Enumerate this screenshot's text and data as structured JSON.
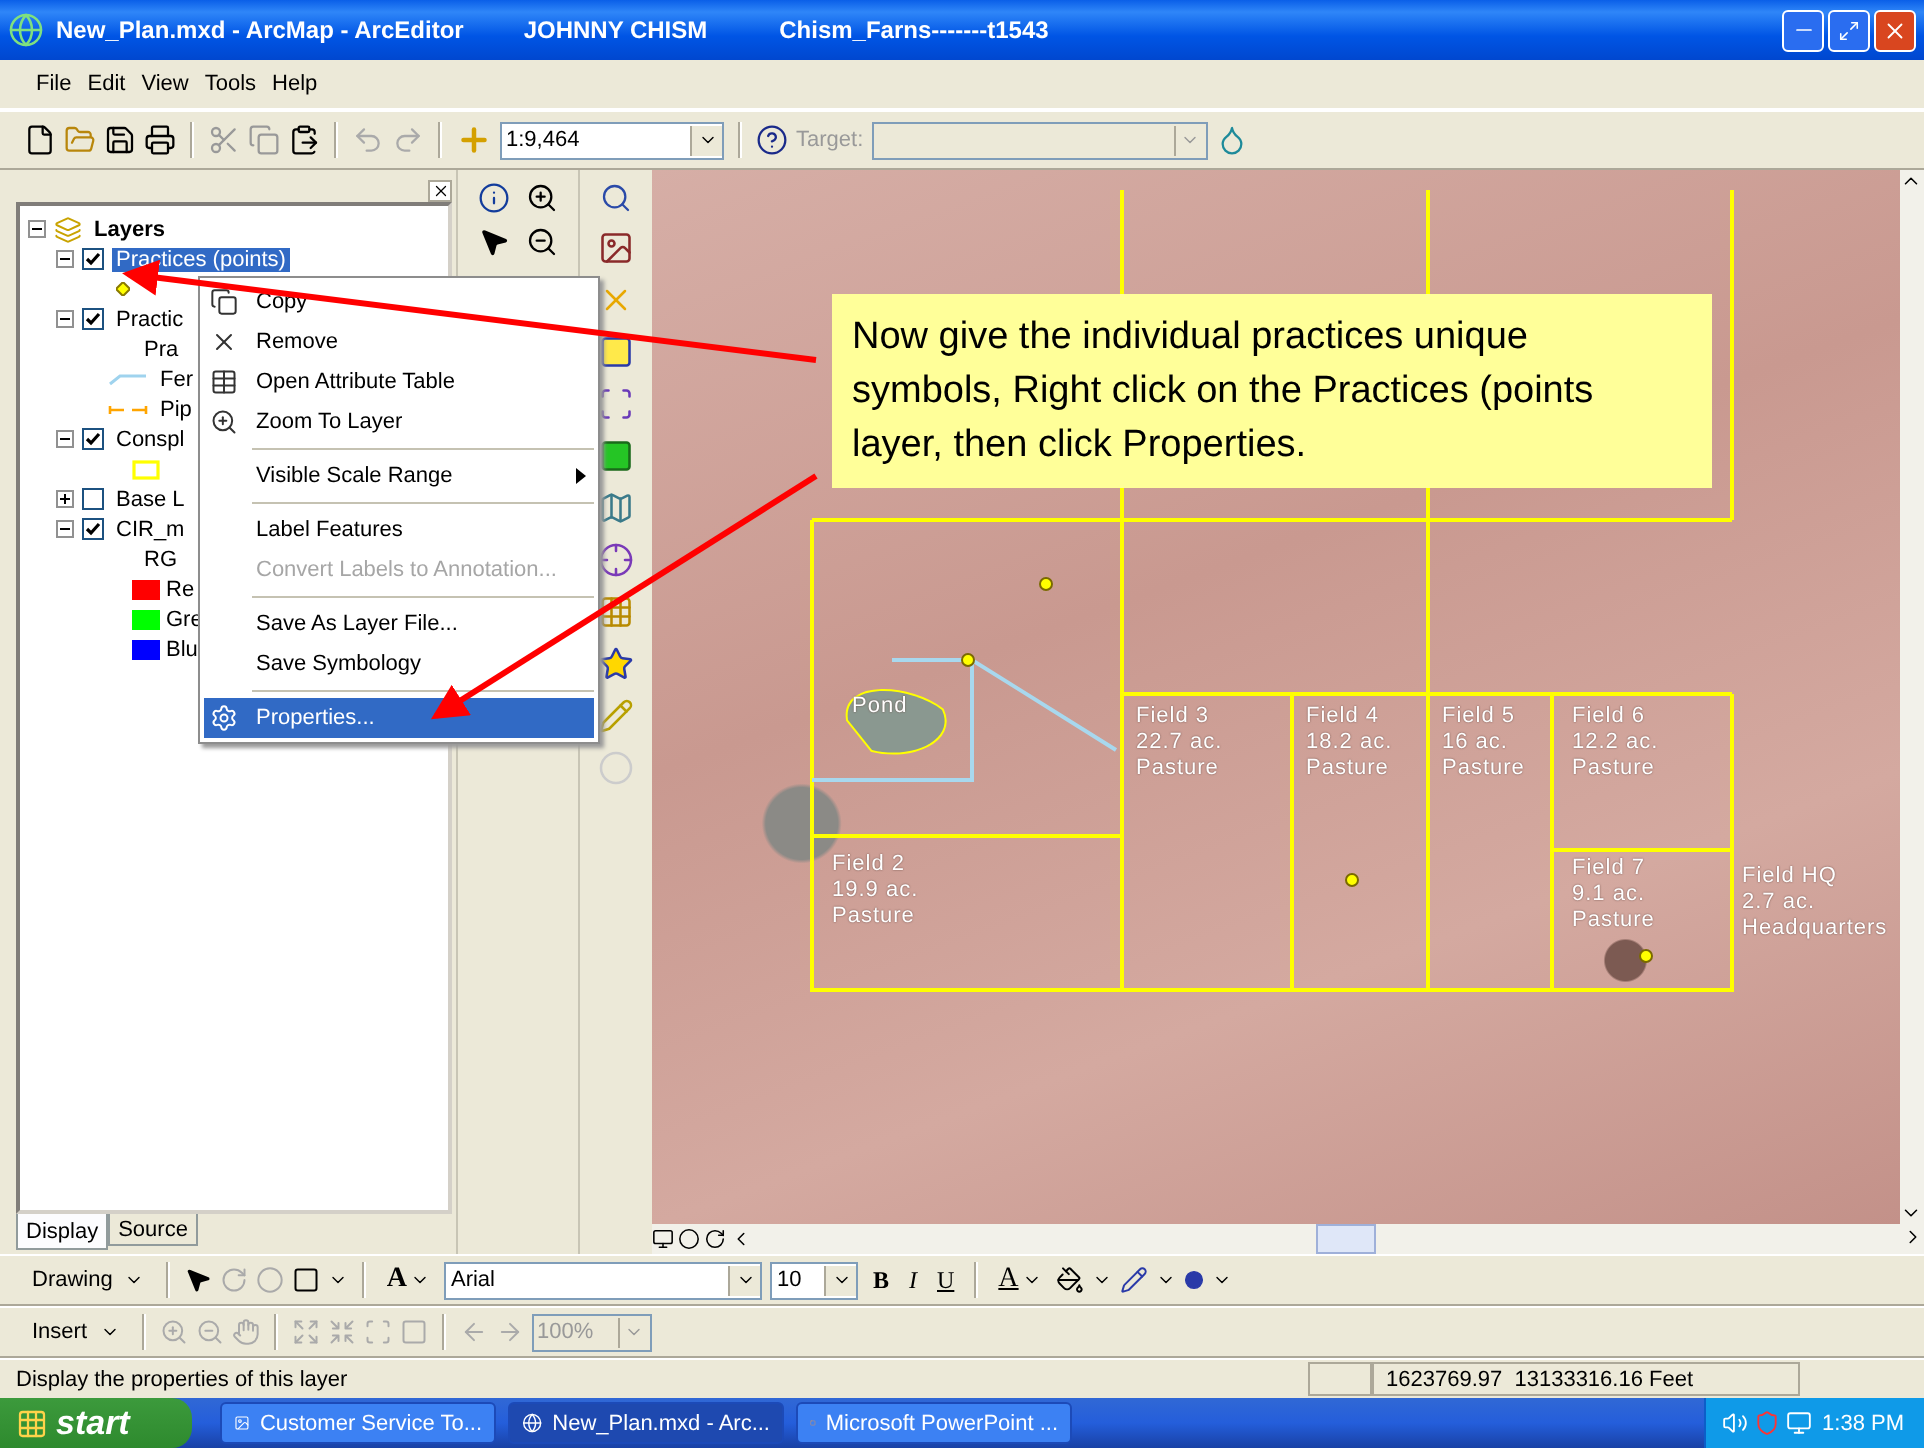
{
  "window": {
    "title_parts": [
      "New_Plan.mxd - ArcMap - ArcEditor",
      "JOHNNY CHISM",
      "Chism_Farns-------t1543"
    ]
  },
  "menu_bar": [
    "File",
    "Edit",
    "View",
    "Tools",
    "Help"
  ],
  "standard_toolbar": {
    "scale": "1:9,464",
    "target_label": "Target:",
    "target_disabled": true
  },
  "toc": {
    "root": "Layers",
    "root_expanded": true,
    "layers": [
      {
        "name": "Practices (points)",
        "checked": true,
        "expanded": true,
        "selected": true,
        "legend": [
          {
            "kind": "point",
            "color": "#ffff00"
          }
        ]
      },
      {
        "name": "Practic",
        "checked": true,
        "expanded": true,
        "selected": false,
        "legend": [
          {
            "kind": "heading",
            "label": "Pra"
          },
          {
            "kind": "line",
            "label": "Fer",
            "color": "#9fd3ee"
          },
          {
            "kind": "dashed",
            "label": "Pip",
            "color": "#ffa500"
          }
        ]
      },
      {
        "name": "Conspl",
        "checked": true,
        "expanded": true,
        "selected": false,
        "legend": [
          {
            "kind": "outline",
            "color": "#ffff00"
          }
        ]
      },
      {
        "name": "Base L",
        "checked": false,
        "expanded": false,
        "selected": false
      },
      {
        "name": "CIR_m",
        "checked": true,
        "expanded": true,
        "selected": false,
        "legend": [
          {
            "kind": "heading",
            "label": "RG"
          },
          {
            "kind": "fill",
            "label": "Re",
            "color": "#ff0000"
          },
          {
            "kind": "fill",
            "label": "Gre",
            "color": "#00ff00"
          },
          {
            "kind": "fill",
            "label": "Blu",
            "color": "#0000ff"
          }
        ]
      }
    ],
    "tabs": [
      {
        "label": "Display",
        "selected": true
      },
      {
        "label": "Source",
        "selected": false
      }
    ]
  },
  "context_menu": {
    "items": [
      {
        "kind": "item",
        "label": "Copy",
        "disabled": false,
        "selected": false
      },
      {
        "kind": "item",
        "label": "Remove",
        "disabled": false,
        "selected": false
      },
      {
        "kind": "item",
        "label": "Open Attribute Table",
        "disabled": false,
        "selected": false
      },
      {
        "kind": "item",
        "label": "Zoom To Layer",
        "disabled": false,
        "selected": false
      },
      {
        "kind": "separator"
      },
      {
        "kind": "submenu",
        "label": "Visible Scale Range",
        "disabled": false,
        "selected": false
      },
      {
        "kind": "separator"
      },
      {
        "kind": "item",
        "label": "Label Features",
        "disabled": false,
        "selected": false
      },
      {
        "kind": "item",
        "label": "Convert Labels to Annotation...",
        "disabled": true,
        "selected": false
      },
      {
        "kind": "separator"
      },
      {
        "kind": "item",
        "label": "Save As Layer File...",
        "disabled": false,
        "selected": false
      },
      {
        "kind": "item",
        "label": "Save Symbology",
        "disabled": false,
        "selected": false
      },
      {
        "kind": "separator"
      },
      {
        "kind": "item",
        "label": "Properties...",
        "disabled": false,
        "selected": true
      }
    ]
  },
  "map": {
    "labels": [
      {
        "lines": [
          "Pond"
        ]
      },
      {
        "lines": [
          "Field 3",
          "22.7 ac.",
          "Pasture"
        ]
      },
      {
        "lines": [
          "Field 4",
          "18.2 ac.",
          "Pasture"
        ]
      },
      {
        "lines": [
          "Field 5",
          "16 ac.",
          "Pasture"
        ]
      },
      {
        "lines": [
          "Field 6",
          "12.2 ac.",
          "Pasture"
        ]
      },
      {
        "lines": [
          "Field 2",
          "19.9 ac.",
          "Pasture"
        ]
      },
      {
        "lines": [
          "Field 7",
          "9.1 ac.",
          "Pasture"
        ]
      },
      {
        "lines": [
          "Field HQ",
          "2.7 ac.",
          "Headquarters"
        ]
      }
    ]
  },
  "callout": {
    "text": "Now give the individual practices unique symbols, Right click on the Practices (points layer, then click Properties."
  },
  "drawing_toolbar": {
    "menu": "Drawing",
    "text_tool": "A",
    "font": "Arial",
    "font_size": "10",
    "styles": [
      "B",
      "I",
      "U"
    ],
    "font_color": "A"
  },
  "insert_toolbar": {
    "menu": "Insert",
    "zoom": "100%",
    "zoom_disabled": true
  },
  "status_bar": {
    "message": "Display the properties of this layer",
    "coordinates": "1623769.97  13133316.16 Feet"
  },
  "taskbar": {
    "start": "start",
    "tasks": [
      {
        "label": "Customer Service To...",
        "selected": false
      },
      {
        "label": "New_Plan.mxd - Arc...",
        "selected": true
      },
      {
        "label": "Microsoft PowerPoint ...",
        "selected": false
      }
    ],
    "clock": "1:38 PM"
  }
}
